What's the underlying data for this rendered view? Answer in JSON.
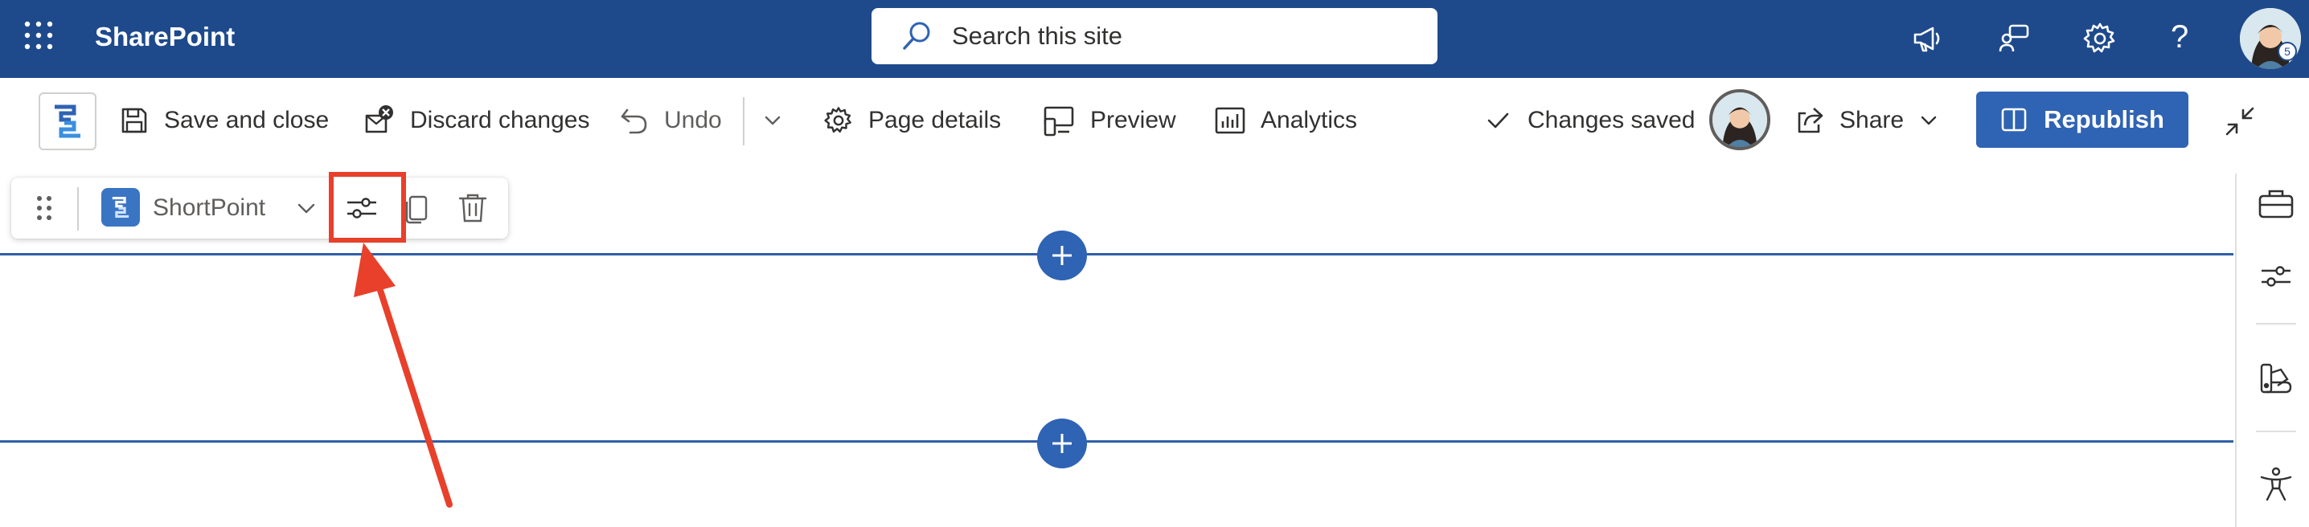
{
  "suite": {
    "app_name": "SharePoint",
    "search_placeholder": "Search this site",
    "help_glyph": "?",
    "user_badge": "5",
    "icons": [
      "waffle-icon",
      "megaphone-icon",
      "feedback-icon",
      "gear-icon",
      "help-icon"
    ]
  },
  "command_bar": {
    "save_label": "Save and close",
    "discard_label": "Discard changes",
    "undo_label": "Undo",
    "page_details_label": "Page details",
    "preview_label": "Preview",
    "analytics_label": "Analytics",
    "status_label": "Changes saved",
    "share_label": "Share",
    "republish_label": "Republish"
  },
  "webpart_toolbar": {
    "name": "ShortPoint",
    "icons": [
      "drag-handle-icon",
      "shortpoint-logo",
      "chevron-down-icon",
      "settings-sliders-icon",
      "duplicate-icon",
      "trash-icon"
    ]
  },
  "right_rail": {
    "icons": [
      "toolbox-icon",
      "properties-icon",
      "design-ideas-icon",
      "accessibility-icon"
    ]
  },
  "colors": {
    "suite_bar": "#1e4a8c",
    "primary": "#2f63b3",
    "highlight": "#e8402a"
  }
}
